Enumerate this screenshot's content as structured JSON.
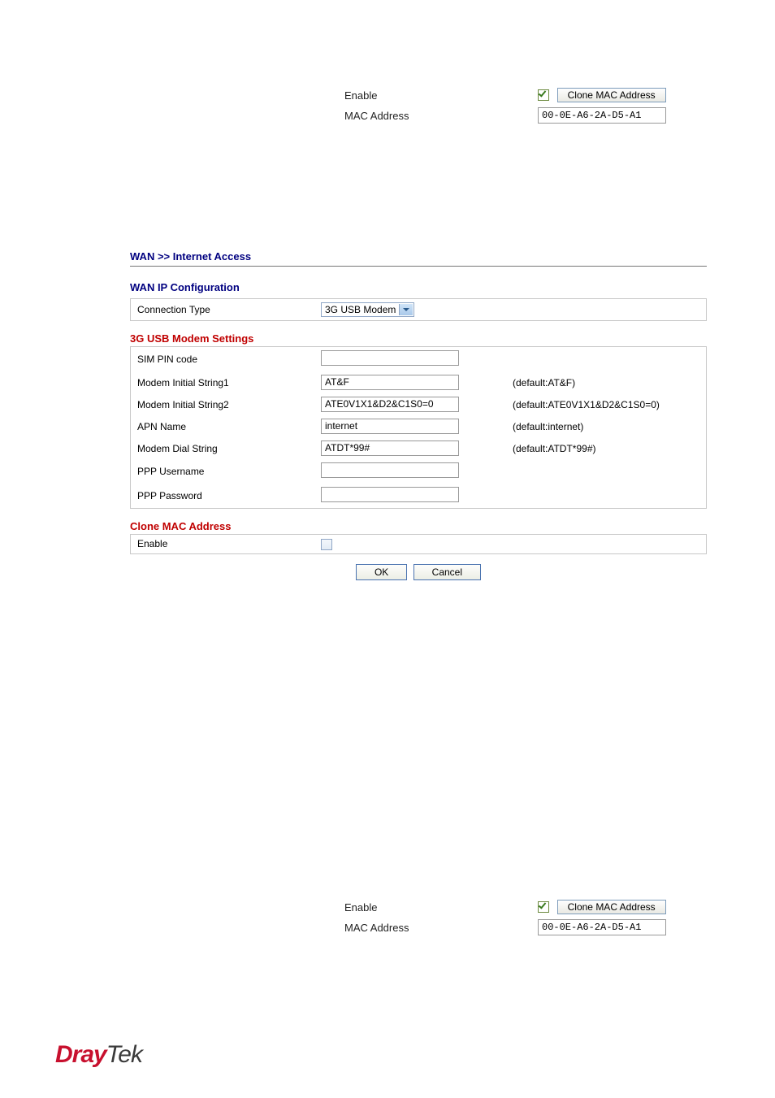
{
  "snippet": {
    "enable_label": "Enable",
    "mac_label": "MAC Address",
    "clone_button": "Clone MAC Address",
    "mac_value": "00-0E-A6-2A-D5-A1"
  },
  "admin": {
    "breadcrumb": "WAN >> Internet Access",
    "wan_ip_title": "WAN IP Configuration",
    "connection_type_label": "Connection Type",
    "connection_type_value": "3G USB Modem",
    "modem_section_title": "3G USB Modem Settings",
    "rows": {
      "sim_pin": {
        "label": "SIM PIN code",
        "value": "",
        "default": ""
      },
      "mis1": {
        "label": "Modem Initial String1",
        "value": "AT&F",
        "default": "(default:AT&F)"
      },
      "mis2": {
        "label": "Modem Initial String2",
        "value": "ATE0V1X1&D2&C1S0=0",
        "default": "(default:ATE0V1X1&D2&C1S0=0)"
      },
      "apn": {
        "label": "APN Name",
        "value": "internet",
        "default": "(default:internet)"
      },
      "dial": {
        "label": "Modem Dial String",
        "value": "ATDT*99#",
        "default": "(default:ATDT*99#)"
      },
      "ppp_u": {
        "label": "PPP Username",
        "value": "",
        "default": ""
      },
      "ppp_p": {
        "label": "PPP Password",
        "value": "",
        "default": ""
      }
    },
    "clone_section_title": "Clone MAC Address",
    "clone_enable_label": "Enable",
    "ok_label": "OK",
    "cancel_label": "Cancel"
  },
  "footer": {
    "brand_bold": "Dray",
    "brand_light": "Tek"
  }
}
